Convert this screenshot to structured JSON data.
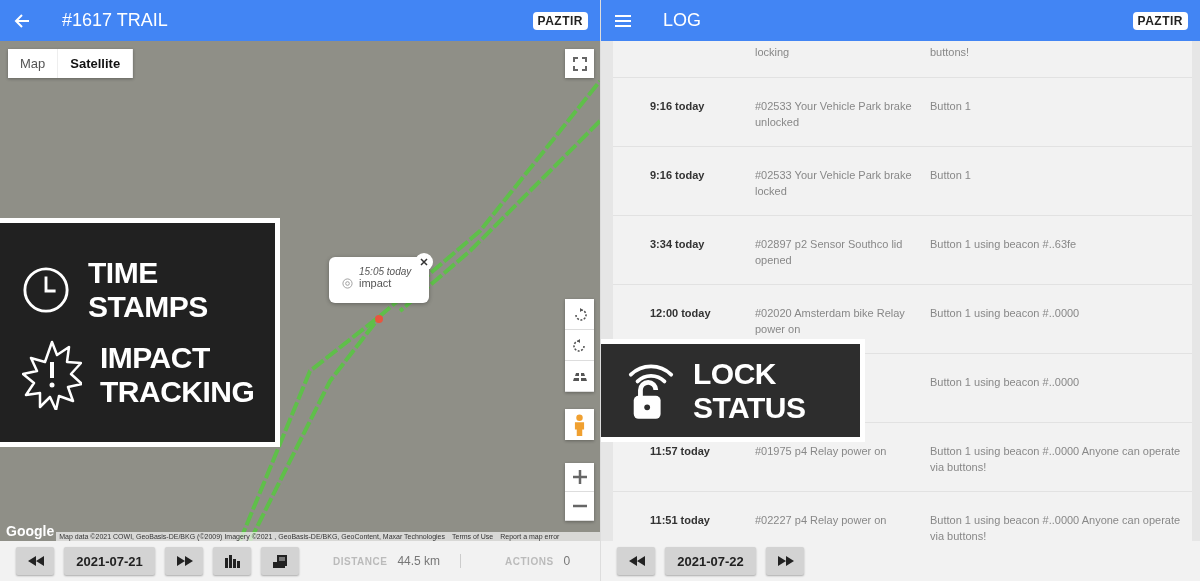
{
  "trail_screen": {
    "header": {
      "title": "#1617 TRAIL",
      "logo": "PAZTIR"
    },
    "map": {
      "map_types": [
        {
          "label": "Map",
          "selected": false
        },
        {
          "label": "Satellite",
          "selected": true
        }
      ],
      "popup": {
        "time": "15:05 today",
        "event": "impact"
      },
      "attribution": {
        "brand": "Google",
        "data": "Map data ©2021 COWI, GeoBasis-DE/BKG (©2009) Imagery ©2021 , GeoBasis-DE/BKG, GeoContent, Maxar Technologies",
        "terms": "Terms of Use",
        "report": "Report a map error"
      }
    },
    "footer": {
      "date": "2021-07-21",
      "stats": [
        {
          "label": "DISTANCE",
          "value": "44.5 km"
        },
        {
          "label": "ACTIONS",
          "value": "0"
        }
      ]
    }
  },
  "left_callout": {
    "features": [
      {
        "kind": "clock",
        "label": "TIME STAMPS"
      },
      {
        "kind": "impact",
        "label": "IMPACT TRACKING"
      }
    ]
  },
  "log_screen": {
    "header": {
      "title": "LOG",
      "logo": "PAZTIR"
    },
    "entries": [
      {
        "description": "locking",
        "detail": "buttons!"
      },
      {
        "time": "9:16 today",
        "description": "#02533 Your Vehicle Park brake unlocked",
        "detail": "Button 1"
      },
      {
        "time": "9:16 today",
        "description": "#02533 Your Vehicle Park brake locked",
        "detail": "Button 1"
      },
      {
        "time": "3:34 today",
        "description": "#02897 p2 Sensor Southco lid opened",
        "detail": "Button 1 using beacon #..63fe"
      },
      {
        "time": "12:00 today",
        "description": "#02020 Amsterdam bike Relay power on",
        "detail": "Button 1 using beacon #..0000"
      },
      {
        "detail": "Button 1 using beacon #..0000"
      },
      {
        "time": "11:57 today",
        "description": "#01975 p4 Relay power on",
        "detail": "Button 1 using beacon #..0000 Anyone can operate via buttons!"
      },
      {
        "time": "11:51 today",
        "description": "#02227 p4 Relay power on",
        "detail": "Button 1 using beacon #..0000 Anyone can operate via buttons!"
      }
    ],
    "footer": {
      "date": "2021-07-22"
    }
  },
  "right_callout": {
    "features": [
      {
        "kind": "lock",
        "label": "LOCK STATUS"
      }
    ]
  }
}
